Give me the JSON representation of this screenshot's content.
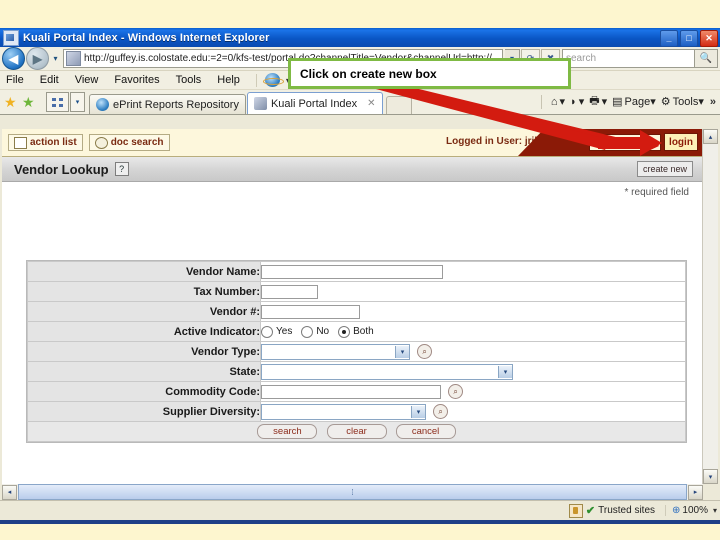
{
  "window": {
    "title": "Kuali Portal Index - Windows Internet Explorer",
    "icon": "page-icon",
    "controls": {
      "minimize": "_",
      "maximize": "□",
      "close": "✕"
    }
  },
  "address_bar": {
    "back_glyph": "◀",
    "forward_glyph": "▶",
    "history_glyph": "▾",
    "url": "http://guffey.is.colostate.edu:=2=0/kfs-test/portal.do?channelTitle=Vendor&channelUrl=http://",
    "dropdown_glyph": "▾",
    "refresh_glyph": "✖",
    "stop_glyph": "⟳",
    "go_glyph": "▾",
    "search_placeholder": "search",
    "search_glyph": "🔍",
    "search_drop_glyph": "▾"
  },
  "menu_bar": {
    "items": [
      "File",
      "Edit",
      "View",
      "Favorites",
      "Tools",
      "Help"
    ],
    "ie_icon": "internet-explorer-icon",
    "chevron": "▾"
  },
  "tab_bar": {
    "favorites_star": "★",
    "add_favorite_star": "★",
    "quick_tabs_glyph": "grid-icon",
    "tab_list_glyph": "▾",
    "tabs": [
      {
        "label": "ePrint Reports Repository",
        "active": false,
        "icon": "ie-page-icon"
      },
      {
        "label": "Kuali Portal Index",
        "active": true,
        "icon": "kuali-page-icon",
        "close": "✕"
      }
    ],
    "command_items": [
      {
        "label": "",
        "icon": "home-icon",
        "chevron": "▾"
      },
      {
        "label": "",
        "icon": "rss-icon",
        "chevron": "▾"
      },
      {
        "label": "",
        "icon": "print-icon",
        "chevron": "▾"
      },
      {
        "label": "Page",
        "icon": "page-icon",
        "chevron": "▾"
      },
      {
        "label": "Tools",
        "icon": "gear-icon",
        "chevron": "▾"
      }
    ],
    "overflow_glyph": "»"
  },
  "portal": {
    "action_list_label": "action list",
    "doc_search_label": "doc search",
    "logged_in_text": "Logged in User: jriba",
    "login_button_label": "login",
    "login_input_value": "",
    "page_title": "Vendor Lookup",
    "help_glyph": "?",
    "create_new_label": "create new",
    "required_note": "* required field"
  },
  "form": {
    "rows": [
      {
        "label": "Vendor Name:",
        "control": "text",
        "value": "",
        "width": "w-vendorname"
      },
      {
        "label": "Tax Number:",
        "control": "text",
        "value": "",
        "width": "w-tax"
      },
      {
        "label": "Vendor #:",
        "control": "text",
        "value": "",
        "width": "w-num"
      },
      {
        "label": "Active Indicator:",
        "control": "radio",
        "value": "Both"
      },
      {
        "label": "Vendor Type:",
        "control": "select-lookup",
        "value": "",
        "width": "w-type"
      },
      {
        "label": "State:",
        "control": "select",
        "value": "",
        "width": "w-state"
      },
      {
        "label": "Commodity Code:",
        "control": "text-lookup",
        "value": "",
        "width": "w-commodity"
      },
      {
        "label": "Supplier Diversity:",
        "control": "select-lookup",
        "value": "",
        "width": "w-supp"
      }
    ],
    "radio_options": [
      "Yes",
      "No",
      "Both"
    ],
    "radio_selected": "Both",
    "select_arrow": "▾",
    "lookup_glyph": "🔍",
    "buttons": [
      "search",
      "clear",
      "cancel"
    ]
  },
  "scrollbars": {
    "up_glyph": "▴",
    "down_glyph": "▾",
    "left_glyph": "◂",
    "right_glyph": "▸",
    "grip_glyph": "⁞"
  },
  "status_bar": {
    "zone_text": "Trusted sites",
    "zone_check": "✔",
    "lock_icon": "lock-icon",
    "zoom_level": "100%",
    "zoom_icon": "magnifier-plus-icon",
    "zoom_chevron": "▾"
  },
  "annotation": {
    "callout_text": "Click on create new box",
    "callout_border_color": "#7fba44",
    "arrow_color": "#d31b10"
  }
}
